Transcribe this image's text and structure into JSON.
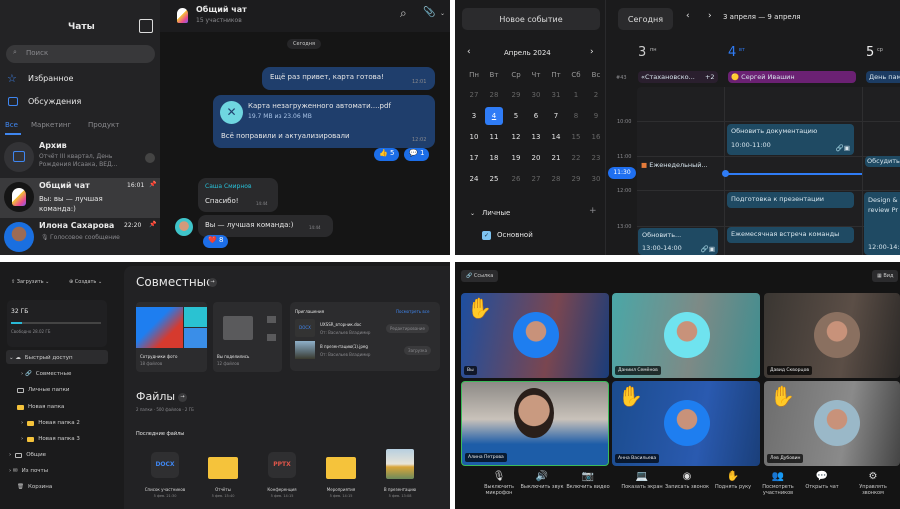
{
  "chat": {
    "sidebar": {
      "title": "Чаты",
      "search_placeholder": "Поиск",
      "favorites": "Избранное",
      "discussions": "Обсуждения",
      "tabs": [
        "Все",
        "Маркетинг",
        "Продукт"
      ],
      "items": [
        {
          "name": "Архив",
          "preview": "Отчёт III квартал, День Рождения Исаака, ВЕД...",
          "time": ""
        },
        {
          "name": "Общий чат",
          "preview": "Вы: вы — лучшая команда:)",
          "time": "16:01"
        },
        {
          "name": "Илона Сахарова",
          "preview": "Голосовое сообщение",
          "time": "22:20"
        }
      ]
    },
    "header": {
      "title": "Общий чат",
      "subtitle": "15 участников"
    },
    "date_divider": "Сегодня",
    "messages": [
      {
        "text": "Ещё раз привет, карта готова!",
        "time": "12:01"
      },
      {
        "file_name": "Карта незагруженного автомати....pdf",
        "file_size": "19.7 MB из 23.06 MB",
        "text": "Всё поправили и актуализировали",
        "time": "12:02",
        "reactions": [
          "5",
          "1"
        ]
      },
      {
        "author": "Саша Смирнов",
        "text": "Спасибо!",
        "time": "14:44"
      },
      {
        "text": "Вы — лучшая команда:)",
        "time": "14:44",
        "reactions": [
          "8"
        ]
      }
    ]
  },
  "calendar": {
    "new_event": "Новое событие",
    "month": "Апрель 2024",
    "weekdays": [
      "Пн",
      "Вт",
      "Ср",
      "Чт",
      "Пт",
      "Сб",
      "Вс"
    ],
    "days": [
      [
        "27",
        "28",
        "29",
        "30",
        "31",
        "1",
        "2"
      ],
      [
        "3",
        "4",
        "5",
        "6",
        "7",
        "8",
        "9"
      ],
      [
        "10",
        "11",
        "12",
        "13",
        "14",
        "15",
        "16"
      ],
      [
        "17",
        "18",
        "19",
        "20",
        "21",
        "22",
        "23"
      ],
      [
        "24",
        "25",
        "26",
        "27",
        "28",
        "29",
        "30"
      ]
    ],
    "selected_day": "4",
    "section": "Личные",
    "calendar_item": "Основной",
    "today": "Сегодня",
    "range": "3 апреля — 9 апреля",
    "columns": [
      {
        "num": "3",
        "dow": "пн"
      },
      {
        "num": "4",
        "dow": "вт"
      },
      {
        "num": "5",
        "dow": "ср"
      }
    ],
    "week": "#43",
    "allday": [
      "«Стахановско...",
      "+2",
      "Сергей Ивашин",
      "День пам"
    ],
    "hours": [
      "10:00",
      "11:00",
      "12:00",
      "13:00"
    ],
    "now": "11:30",
    "events": {
      "e1": "Обновить документацию",
      "e1t": "10:00-11:00",
      "e2": "Еженедельный...",
      "e3": "Обсудить",
      "e4": "Подготовка к презентации",
      "e5": "Ежемесячная встреча команды",
      "e6": "Обновить...",
      "e6t": "13:00-14:00",
      "e7": "Design & review Pr",
      "e7t": "12:00-14:"
    },
    "accent": "#2f7cf6"
  },
  "files": {
    "upload": "Загрузить",
    "create": "Создать",
    "storage": {
      "total": "32 ГБ",
      "free": "Свободно 28.02 ГБ",
      "used_fraction": 0.12
    },
    "tree": [
      "Быстрый доступ",
      "Совместные",
      "Личные папки",
      "Новая папка",
      "Новая папка 2",
      "Новая папка 3",
      "Общие",
      "Из почты",
      "Корзина"
    ],
    "shared_title": "Совместные",
    "shared_cards": [
      {
        "name": "Сотрудники фото",
        "count": "18 файлов"
      },
      {
        "name": "Вы поделились",
        "count": "12 файлов"
      }
    ],
    "invitations": {
      "title": "Приглашения",
      "view_all": "Посмотреть все",
      "items": [
        {
          "name": "UXSSR_вторник.doc",
          "from": "От: Васильев Владимир",
          "action": "Редактирование",
          "thumb": "DOCX"
        },
        {
          "name": "В презентацию(1).jpeg",
          "from": "От: Васильев Владимир",
          "action": "Загрузка"
        }
      ]
    },
    "files_title": "Файлы",
    "files_meta": "2 папки · 500 файлов · 2 ГБ",
    "recent_title": "Последние файлы",
    "recent": [
      {
        "name": "Список участников",
        "date": "5 фев. 21:30",
        "badge": "DOCX"
      },
      {
        "name": "Отчёты",
        "date": "5 фев. 15:40"
      },
      {
        "name": "Конференция",
        "date": "5 фев. 14:15",
        "badge": "PPTX"
      },
      {
        "name": "Мероприятия",
        "date": "5 фев. 14:15"
      },
      {
        "name": "В презентацию",
        "date": "5 фев. 13:08"
      }
    ]
  },
  "video": {
    "link": "Ссылка",
    "view": "Вид",
    "participants": [
      "Вы",
      "Даниил Семёнов",
      "Давид Скворцов",
      "Алина Петрова",
      "Анна Васильева",
      "Лев Дубовин"
    ],
    "toolbar": [
      "Выключить микрофон",
      "Выключить звук",
      "Включить видео",
      "Показать экран",
      "Записать звонок",
      "Поднять руку",
      "Посмотреть участников",
      "Открыть чат",
      "Управлять звонком"
    ]
  }
}
